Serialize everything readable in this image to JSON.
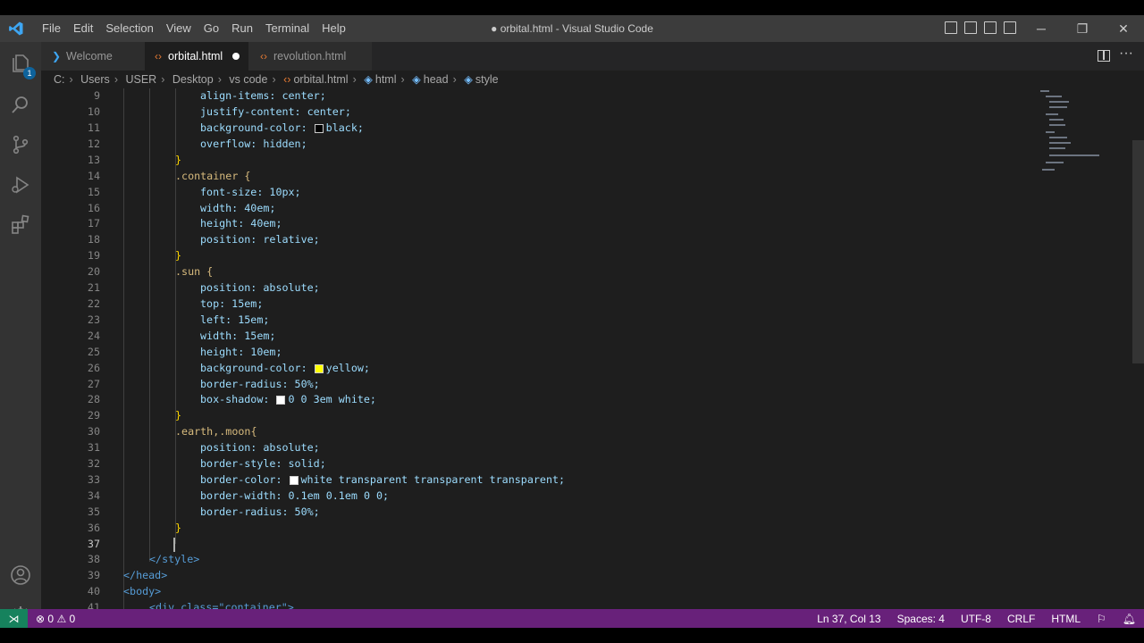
{
  "title_bar": {
    "menus": [
      "File",
      "Edit",
      "Selection",
      "View",
      "Go",
      "Run",
      "Terminal",
      "Help"
    ],
    "window_title": "● orbital.html - Visual Studio Code",
    "controls": {
      "minimize": "─",
      "maximize": "❐",
      "close": "✕"
    }
  },
  "tabs": [
    {
      "label": "Welcome",
      "icon": "vscode-icon",
      "active": false
    },
    {
      "label": "orbital.html",
      "icon": "html-icon",
      "active": true,
      "dirty": true
    },
    {
      "label": "revolution.html",
      "icon": "html-icon",
      "active": false
    }
  ],
  "activity_bar": {
    "explorer_badge": "1"
  },
  "breadcrumb": [
    "C:",
    "Users",
    "USER",
    "Desktop",
    "vs code",
    "orbital.html",
    "html",
    "head",
    "style"
  ],
  "editor": {
    "lines": [
      {
        "n": "9",
        "t": "align-items: center;"
      },
      {
        "n": "10",
        "t": "justify-content: center;"
      },
      {
        "n": "11",
        "t": "background-color: black;"
      },
      {
        "n": "12",
        "t": "overflow: hidden;"
      },
      {
        "n": "13",
        "t": "}"
      },
      {
        "n": "14",
        "t": ".container {"
      },
      {
        "n": "15",
        "t": "font-size: 10px;"
      },
      {
        "n": "16",
        "t": "width: 40em;"
      },
      {
        "n": "17",
        "t": "height: 40em;"
      },
      {
        "n": "18",
        "t": "position: relative;"
      },
      {
        "n": "19",
        "t": "}"
      },
      {
        "n": "20",
        "t": ".sun {"
      },
      {
        "n": "21",
        "t": "position: absolute;"
      },
      {
        "n": "22",
        "t": "top: 15em;"
      },
      {
        "n": "23",
        "t": "left: 15em;"
      },
      {
        "n": "24",
        "t": "width: 15em;"
      },
      {
        "n": "25",
        "t": "height: 10em;"
      },
      {
        "n": "26",
        "t": "background-color: yellow;"
      },
      {
        "n": "27",
        "t": "border-radius: 50%;"
      },
      {
        "n": "28",
        "t": "box-shadow: 0 0 3em white;"
      },
      {
        "n": "29",
        "t": "}"
      },
      {
        "n": "30",
        "t": ".earth,.moon{"
      },
      {
        "n": "31",
        "t": "position: absolute;"
      },
      {
        "n": "32",
        "t": "border-style: solid;"
      },
      {
        "n": "33",
        "t": "border-color: white transparent transparent transparent;"
      },
      {
        "n": "34",
        "t": "border-width: 0.1em 0.1em 0 0;"
      },
      {
        "n": "35",
        "t": "border-radius: 50%;"
      },
      {
        "n": "36",
        "t": "}"
      },
      {
        "n": "37",
        "t": ""
      },
      {
        "n": "38",
        "t": "</style>"
      },
      {
        "n": "39",
        "t": "</head>"
      },
      {
        "n": "40",
        "t": "<body>"
      },
      {
        "n": "41",
        "t": "<div class=\"container\">"
      }
    ],
    "current_line": "37"
  },
  "colors": {
    "statusbar": "#68217a",
    "remote": "#16825d",
    "swatch_black": "#000000",
    "swatch_yellow": "#ffff00",
    "swatch_white": "#ffffff"
  },
  "status_bar": {
    "errors": "0",
    "warnings": "0",
    "cursor": "Ln 37, Col 13",
    "spaces": "Spaces: 4",
    "encoding": "UTF-8",
    "eol": "CRLF",
    "language": "HTML"
  }
}
